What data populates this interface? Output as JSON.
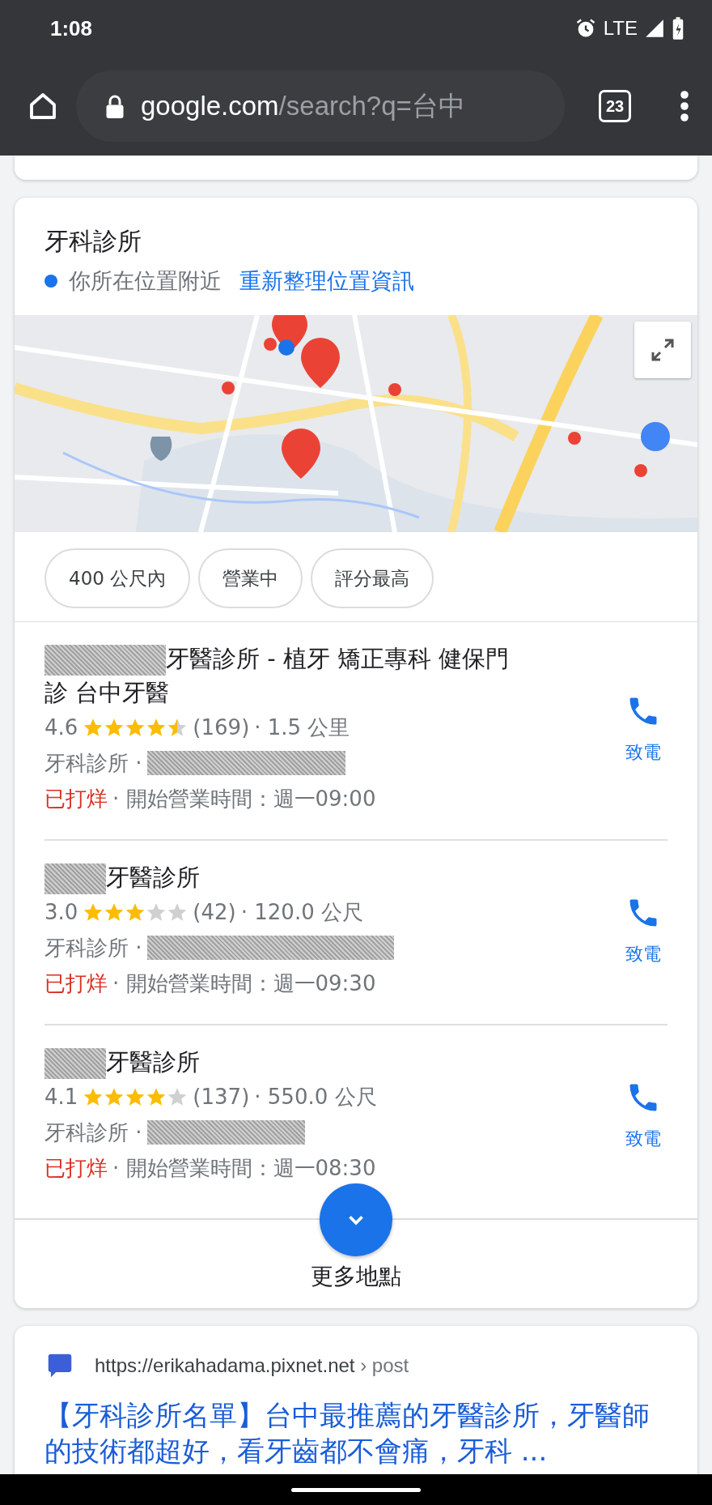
{
  "status_bar": {
    "time": "1:08",
    "network": "LTE"
  },
  "browser": {
    "url_host": "google.com",
    "url_path": "/search?q=台中",
    "tab_count": "23"
  },
  "local_results": {
    "title": "牙科診所",
    "location_note": "你所在位置附近",
    "refresh_link": "重新整理位置資訊",
    "filters": [
      {
        "label": "400 公尺內"
      },
      {
        "label": "營業中"
      },
      {
        "label": "評分最高"
      }
    ],
    "places": [
      {
        "name": "牙醫診所 - 植牙 矯正專科 健保門診 台中牙醫",
        "rating": "4.6",
        "stars": 4.5,
        "reviews": "(169)",
        "distance": "· 1.5 公里",
        "category": "牙科診所 ·",
        "status": "已打烊",
        "hours": "· 開始營業時間：週一09:00",
        "call_label": "致電"
      },
      {
        "name": "牙醫診所",
        "rating": "3.0",
        "stars": 3,
        "reviews": "(42)",
        "distance": "· 120.0 公尺",
        "category": "牙科診所 ·",
        "status": "已打烊",
        "hours": "· 開始營業時間：週一09:30",
        "call_label": "致電"
      },
      {
        "name": "牙醫診所",
        "rating": "4.1",
        "stars": 4,
        "reviews": "(137)",
        "distance": "· 550.0 公尺",
        "category": "牙科診所 ·",
        "status": "已打烊",
        "hours": "· 開始營業時間：週一08:30",
        "call_label": "致電"
      }
    ],
    "more_label": "更多地點"
  },
  "web_result": {
    "url": "https://erikahadama.pixnet.net",
    "breadcrumb": "› post",
    "title": "【牙科診所名單】台中最推薦的牙醫診所，牙醫師的技術都超好，看牙齒都不會痛，牙科 ..."
  }
}
